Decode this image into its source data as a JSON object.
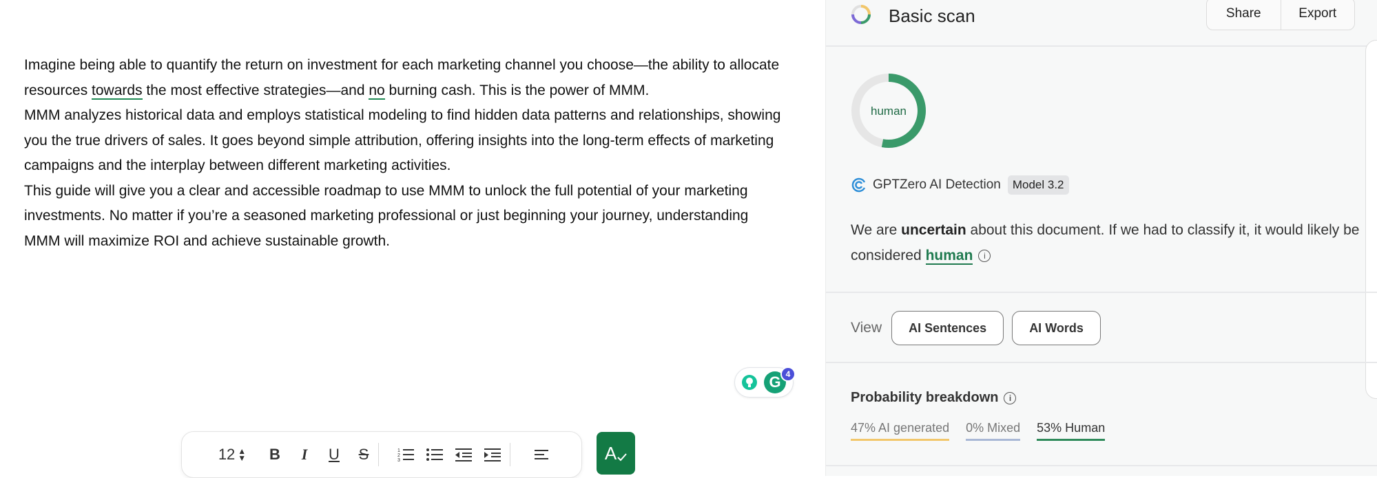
{
  "editor": {
    "paragraphs": [
      {
        "p1": "Imagine being able to quantify the return on investment for each marketing channel you choose—the ability to allocate resources ",
        "u1": "towards",
        "p2": " the most effective strategies—and ",
        "u2": "no",
        "p3": " burning cash. This is the power of MMM."
      },
      {
        "text": "MMM analyzes historical data and employs statistical modeling to find hidden data patterns and relationships, showing you the true drivers of sales. It goes beyond simple attribution, offering insights into the long-term effects of marketing campaigns and the interplay between different marketing activities."
      },
      {
        "text": "This guide will give you a clear and accessible roadmap to use MMM to unlock the full potential of your marketing investments. No matter if you’re a seasoned marketing professional or just beginning your journey, understanding MMM will maximize ROI and achieve sustainable growth."
      }
    ],
    "grammarly_badge": "4",
    "grammarly_letter": "G"
  },
  "toolbar": {
    "font_size": "12",
    "bold": "B",
    "italic": "I",
    "underline": "U",
    "strike": "S",
    "spell_glyph": "A"
  },
  "panel": {
    "title": "Basic scan",
    "share_label": "Share",
    "export_label": "Export",
    "donut_label": "human",
    "donut_human_fraction": 0.53,
    "detector_label": "GPTZero AI Detection",
    "model_badge": "Model 3.2",
    "verdict": {
      "pre": "We are ",
      "uncertain": "uncertain",
      "mid": " about this document. If we had to classify it, it would likely be considered ",
      "human": "human"
    },
    "view_label": "View",
    "view_buttons": [
      "AI Sentences",
      "AI Words"
    ],
    "probability_title": "Probability breakdown",
    "probabilities": [
      {
        "label": "47% AI generated",
        "color": "#f2c76b"
      },
      {
        "label": "0% Mixed",
        "color": "#a9b8d6"
      },
      {
        "label": "53% Human",
        "color": "#2e8a5a"
      }
    ]
  },
  "colors": {
    "accent_green": "#137a45",
    "donut_green": "#3a9a6a",
    "donut_track": "#e6e6e6"
  }
}
